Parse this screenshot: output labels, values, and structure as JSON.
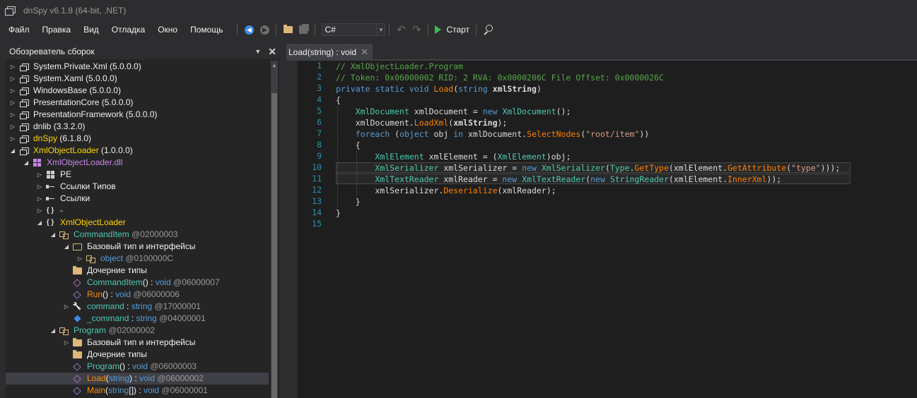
{
  "window": {
    "title": "dnSpy v6.1.8 (64-bit, .NET)"
  },
  "menu": [
    "Файл",
    "Правка",
    "Вид",
    "Отладка",
    "Окно",
    "Помощь"
  ],
  "toolbar": {
    "language": "C#",
    "run_label": "Старт",
    "icons": [
      "back-icon",
      "forward-icon",
      "open-icon",
      "save-all-icon",
      "undo-icon",
      "redo-icon",
      "play-icon",
      "search-icon"
    ]
  },
  "assembly_explorer": {
    "title": "Обозреватель сборок",
    "rows": [
      {
        "depth": 0,
        "expander": "▷",
        "icon": "assembly-icon",
        "parts": [
          {
            "t": "System.Private.Xml",
            "c": "white"
          },
          {
            "t": " (5.0.0.0)",
            "c": "white"
          }
        ]
      },
      {
        "depth": 0,
        "expander": "▷",
        "icon": "assembly-icon",
        "parts": [
          {
            "t": "System.Xaml",
            "c": "white"
          },
          {
            "t": " (5.0.0.0)",
            "c": "white"
          }
        ]
      },
      {
        "depth": 0,
        "expander": "▷",
        "icon": "assembly-icon",
        "parts": [
          {
            "t": "WindowsBase",
            "c": "white"
          },
          {
            "t": " (5.0.0.0)",
            "c": "white"
          }
        ]
      },
      {
        "depth": 0,
        "expander": "▷",
        "icon": "assembly-icon",
        "parts": [
          {
            "t": "PresentationCore",
            "c": "white"
          },
          {
            "t": " (5.0.0.0)",
            "c": "white"
          }
        ]
      },
      {
        "depth": 0,
        "expander": "▷",
        "icon": "assembly-icon",
        "parts": [
          {
            "t": "PresentationFramework",
            "c": "white"
          },
          {
            "t": " (5.0.0.0)",
            "c": "white"
          }
        ]
      },
      {
        "depth": 0,
        "expander": "▷",
        "icon": "assembly-icon",
        "parts": [
          {
            "t": "dnlib",
            "c": "white"
          },
          {
            "t": " (3.3.2.0)",
            "c": "white"
          }
        ]
      },
      {
        "depth": 0,
        "expander": "▷",
        "icon": "assembly-icon",
        "parts": [
          {
            "t": "dnSpy",
            "c": "yellow"
          },
          {
            "t": " (6.1.8.0)",
            "c": "white"
          }
        ]
      },
      {
        "depth": 0,
        "expander": "◢",
        "icon": "assembly-icon",
        "parts": [
          {
            "t": "XmlObjectLoader",
            "c": "yellow"
          },
          {
            "t": " (1.0.0.0)",
            "c": "white"
          }
        ]
      },
      {
        "depth": 1,
        "expander": "◢",
        "icon": "dll-icon",
        "parts": [
          {
            "t": "XmlObjectLoader.dll",
            "c": "purple"
          }
        ]
      },
      {
        "depth": 2,
        "expander": "▷",
        "icon": "pe-icon",
        "parts": [
          {
            "t": "PE",
            "c": "white"
          }
        ]
      },
      {
        "depth": 2,
        "expander": "▷",
        "icon": "type-refs-icon",
        "parts": [
          {
            "t": "Ссылки Типов",
            "c": "white"
          }
        ]
      },
      {
        "depth": 2,
        "expander": "▷",
        "icon": "refs-icon",
        "parts": [
          {
            "t": "Ссылки",
            "c": "white"
          }
        ]
      },
      {
        "depth": 2,
        "expander": "▷",
        "icon": "namespace-icon",
        "parts": [
          {
            "t": "-",
            "c": "white"
          }
        ]
      },
      {
        "depth": 2,
        "expander": "◢",
        "icon": "namespace-icon",
        "parts": [
          {
            "t": "XmlObjectLoader",
            "c": "yellow"
          }
        ]
      },
      {
        "depth": 3,
        "expander": "◢",
        "icon": "class-icon",
        "parts": [
          {
            "t": "CommandItem",
            "c": "teal"
          },
          {
            "t": " @02000003",
            "c": "gray"
          }
        ]
      },
      {
        "depth": 4,
        "expander": "◢",
        "icon": "folder-open-icon",
        "parts": [
          {
            "t": "Базовый тип и интерфейсы",
            "c": "white"
          }
        ]
      },
      {
        "depth": 5,
        "expander": "▷",
        "icon": "class-icon",
        "parts": [
          {
            "t": "object",
            "c": "blue"
          },
          {
            "t": " @0100000C",
            "c": "gray"
          }
        ]
      },
      {
        "depth": 4,
        "expander": "",
        "icon": "folder-icon",
        "parts": [
          {
            "t": "Дочерние типы",
            "c": "white"
          }
        ]
      },
      {
        "depth": 4,
        "expander": "",
        "icon": "method-icon",
        "parts": [
          {
            "t": "CommandItem",
            "c": "teal"
          },
          {
            "t": "() : ",
            "c": "white"
          },
          {
            "t": "void",
            "c": "blue"
          },
          {
            "t": " @06000007",
            "c": "gray"
          }
        ]
      },
      {
        "depth": 4,
        "expander": "",
        "icon": "method-icon",
        "parts": [
          {
            "t": "Run",
            "c": "orange"
          },
          {
            "t": "() : ",
            "c": "white"
          },
          {
            "t": "void",
            "c": "blue"
          },
          {
            "t": " @06000006",
            "c": "gray"
          }
        ]
      },
      {
        "depth": 4,
        "expander": "▷",
        "icon": "property-icon",
        "parts": [
          {
            "t": "command",
            "c": "teal"
          },
          {
            "t": " : ",
            "c": "white"
          },
          {
            "t": "string",
            "c": "blue"
          },
          {
            "t": " @17000001",
            "c": "gray"
          }
        ]
      },
      {
        "depth": 4,
        "expander": "",
        "icon": "field-icon",
        "parts": [
          {
            "t": "_command",
            "c": "teal"
          },
          {
            "t": " : ",
            "c": "white"
          },
          {
            "t": "string",
            "c": "blue"
          },
          {
            "t": " @04000001",
            "c": "gray"
          }
        ]
      },
      {
        "depth": 3,
        "expander": "◢",
        "icon": "class-icon",
        "parts": [
          {
            "t": "Program",
            "c": "teal"
          },
          {
            "t": " @02000002",
            "c": "gray"
          }
        ]
      },
      {
        "depth": 4,
        "expander": "▷",
        "icon": "folder-icon",
        "parts": [
          {
            "t": "Базовый тип и интерфейсы",
            "c": "white"
          }
        ]
      },
      {
        "depth": 4,
        "expander": "",
        "icon": "folder-icon",
        "parts": [
          {
            "t": "Дочерние типы",
            "c": "white"
          }
        ]
      },
      {
        "depth": 4,
        "expander": "",
        "icon": "method-icon",
        "parts": [
          {
            "t": "Program",
            "c": "teal"
          },
          {
            "t": "() : ",
            "c": "white"
          },
          {
            "t": "void",
            "c": "blue"
          },
          {
            "t": " @06000003",
            "c": "gray"
          }
        ]
      },
      {
        "depth": 4,
        "expander": "",
        "icon": "method-icon",
        "selected": true,
        "parts": [
          {
            "t": "Load",
            "c": "orange"
          },
          {
            "t": "(",
            "c": "white"
          },
          {
            "t": "string",
            "c": "blue"
          },
          {
            "t": ") : ",
            "c": "white"
          },
          {
            "t": "void",
            "c": "blue"
          },
          {
            "t": " @06000002",
            "c": "gray"
          }
        ]
      },
      {
        "depth": 4,
        "expander": "",
        "icon": "method-icon",
        "parts": [
          {
            "t": "Main",
            "c": "orange"
          },
          {
            "t": "(",
            "c": "white"
          },
          {
            "t": "string",
            "c": "blue"
          },
          {
            "t": "[]) : ",
            "c": "white"
          },
          {
            "t": "void",
            "c": "blue"
          },
          {
            "t": " @06000001",
            "c": "gray"
          }
        ]
      }
    ]
  },
  "editor": {
    "tab_label": "Load(string) : void",
    "lines": [
      [
        [
          "// XmlObjectLoader.Program",
          "comment"
        ]
      ],
      [
        [
          "// Token: 0x06000002 RID: 2 RVA: 0x0000206C File Offset: 0x0000026C",
          "comment"
        ]
      ],
      [
        [
          "private",
          "kw"
        ],
        [
          " ",
          "plain"
        ],
        [
          "static",
          "kw"
        ],
        [
          " ",
          "plain"
        ],
        [
          "void",
          "kw"
        ],
        [
          " ",
          "plain"
        ],
        [
          "Load",
          "method"
        ],
        [
          "(",
          "plain"
        ],
        [
          "string",
          "kw"
        ],
        [
          " ",
          "plain"
        ],
        [
          "xmlString",
          "bold"
        ],
        [
          ")",
          "plain"
        ]
      ],
      [
        [
          "{",
          "plain"
        ]
      ],
      [
        [
          "    ",
          "plain"
        ],
        [
          "XmlDocument",
          "type"
        ],
        [
          " xmlDocument = ",
          "plain"
        ],
        [
          "new",
          "kw"
        ],
        [
          " ",
          "plain"
        ],
        [
          "XmlDocument",
          "type"
        ],
        [
          "();",
          "plain"
        ]
      ],
      [
        [
          "    xmlDocument.",
          "plain"
        ],
        [
          "LoadXml",
          "method"
        ],
        [
          "(",
          "plain"
        ],
        [
          "xmlString",
          "bold"
        ],
        [
          ");",
          "plain"
        ]
      ],
      [
        [
          "    ",
          "plain"
        ],
        [
          "foreach",
          "kw"
        ],
        [
          " (",
          "plain"
        ],
        [
          "object",
          "kw"
        ],
        [
          " obj ",
          "plain"
        ],
        [
          "in",
          "kw"
        ],
        [
          " xmlDocument.",
          "plain"
        ],
        [
          "SelectNodes",
          "method"
        ],
        [
          "(",
          "plain"
        ],
        [
          "\"root/item\"",
          "str"
        ],
        [
          "))",
          "plain"
        ]
      ],
      [
        [
          "    {",
          "plain"
        ]
      ],
      [
        [
          "        ",
          "plain"
        ],
        [
          "XmlElement",
          "type"
        ],
        [
          " xmlElement = (",
          "plain"
        ],
        [
          "XmlElement",
          "type"
        ],
        [
          ")obj;",
          "plain"
        ]
      ],
      [
        [
          "        ",
          "plain"
        ],
        [
          "XmlSerializer",
          "type"
        ],
        [
          " xmlSerializer = ",
          "plain"
        ],
        [
          "new",
          "kw"
        ],
        [
          " ",
          "plain"
        ],
        [
          "XmlSerializer",
          "type"
        ],
        [
          "(",
          "plain"
        ],
        [
          "Type",
          "type"
        ],
        [
          ".",
          "plain"
        ],
        [
          "GetType",
          "method"
        ],
        [
          "(xmlElement.",
          "plain"
        ],
        [
          "GetAttribute",
          "method"
        ],
        [
          "(",
          "plain"
        ],
        [
          "\"type\"",
          "str"
        ],
        [
          ")));",
          "plain"
        ]
      ],
      [
        [
          "        ",
          "plain"
        ],
        [
          "XmlTextReader",
          "type"
        ],
        [
          " xmlReader = ",
          "plain"
        ],
        [
          "new",
          "kw"
        ],
        [
          " ",
          "plain"
        ],
        [
          "XmlTextReader",
          "type"
        ],
        [
          "(",
          "plain"
        ],
        [
          "new",
          "kw"
        ],
        [
          " ",
          "plain"
        ],
        [
          "StringReader",
          "type"
        ],
        [
          "(xmlElement.",
          "plain"
        ],
        [
          "InnerXml",
          "method"
        ],
        [
          "));",
          "plain"
        ]
      ],
      [
        [
          "        xmlSerializer.",
          "plain"
        ],
        [
          "Deserialize",
          "method"
        ],
        [
          "(xmlReader);",
          "plain"
        ]
      ],
      [
        [
          "    }",
          "plain"
        ]
      ],
      [
        [
          "}",
          "plain"
        ]
      ],
      []
    ],
    "line_numbers": [
      "1",
      "2",
      "3",
      "4",
      "5",
      "6",
      "7",
      "8",
      "9",
      "10",
      "11",
      "12",
      "13",
      "14",
      "15"
    ],
    "highlighted_lines": [
      10,
      11
    ]
  },
  "colors": {
    "background": "#2d2d30",
    "editor_bg": "#1e1e1e",
    "panel_bg": "#252526",
    "selection": "#3f3f46",
    "accent_blue": "#3e8ce0",
    "run_green": "#3fb950"
  }
}
